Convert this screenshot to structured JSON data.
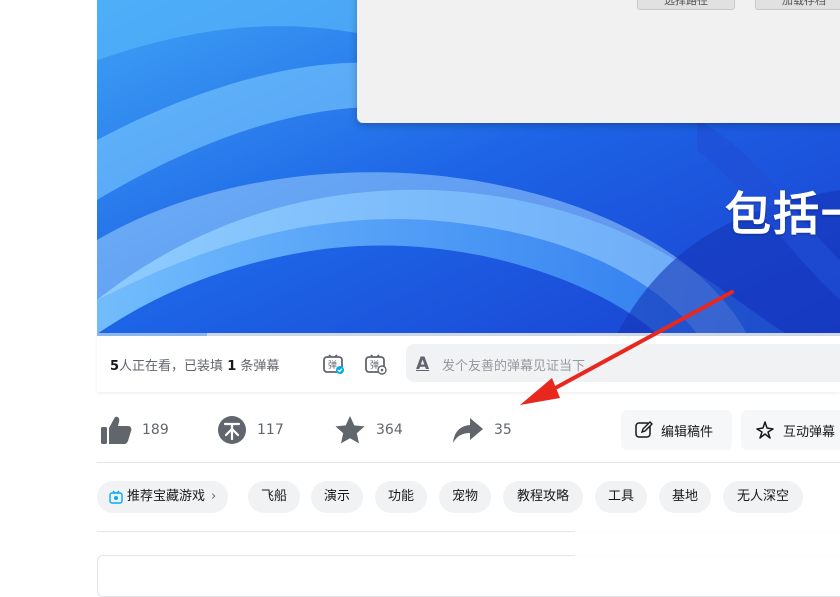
{
  "dialog": {
    "buttons": [
      "选择路径",
      "加载存档"
    ]
  },
  "video": {
    "subtitle": "包括一些我"
  },
  "danmaku": {
    "viewers_count": "5",
    "viewers_text": "人正在看，已装填",
    "danmaku_count": "1",
    "danmaku_suffix": "条弹幕",
    "input_placeholder": "发个友善的弹幕见证当下"
  },
  "actions": {
    "like": "189",
    "coin": "117",
    "favorite": "364",
    "share": "35",
    "edit_label": "编辑稿件",
    "interactive_label": "互动弹幕"
  },
  "tags": [
    "推荐宝藏游戏",
    "飞船",
    "演示",
    "功能",
    "宠物",
    "教程攻略",
    "工具",
    "基地",
    "无人深空"
  ],
  "colors": {
    "accent": "#00aeec",
    "annotation_arrow": "#e8271f",
    "icon_gray": "#61666d"
  }
}
